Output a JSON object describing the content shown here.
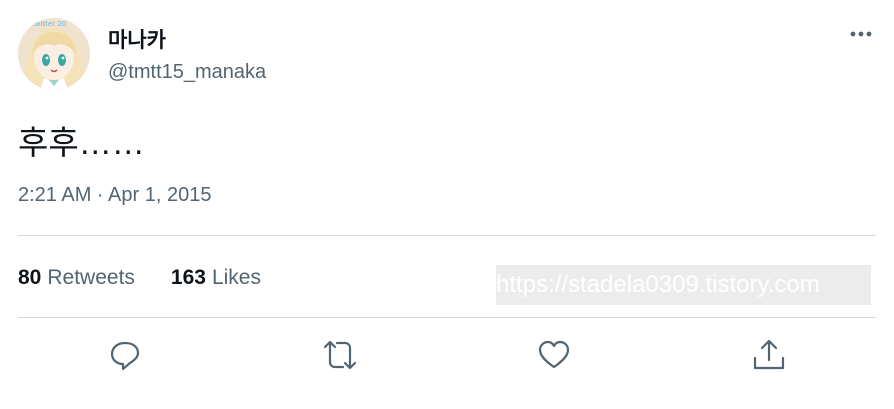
{
  "tweet": {
    "display_name": "마나카",
    "handle": "@tmtt15_manaka",
    "text": "후후……",
    "timestamp": "2:21 AM · Apr 1, 2015"
  },
  "stats": {
    "retweets_count": "80",
    "retweets_label": "Retweets",
    "likes_count": "163",
    "likes_label": "Likes"
  },
  "watermark": "https://stadela0309.tistory.com",
  "avatar_badge": "twitter 20",
  "icons": {
    "more": "more-horizontal-icon",
    "reply": "reply-icon",
    "retweet": "retweet-icon",
    "like": "heart-icon",
    "share": "share-icon"
  },
  "colors": {
    "text_primary": "#0f1419",
    "text_secondary": "#536471",
    "divider": "#cfd9de"
  }
}
